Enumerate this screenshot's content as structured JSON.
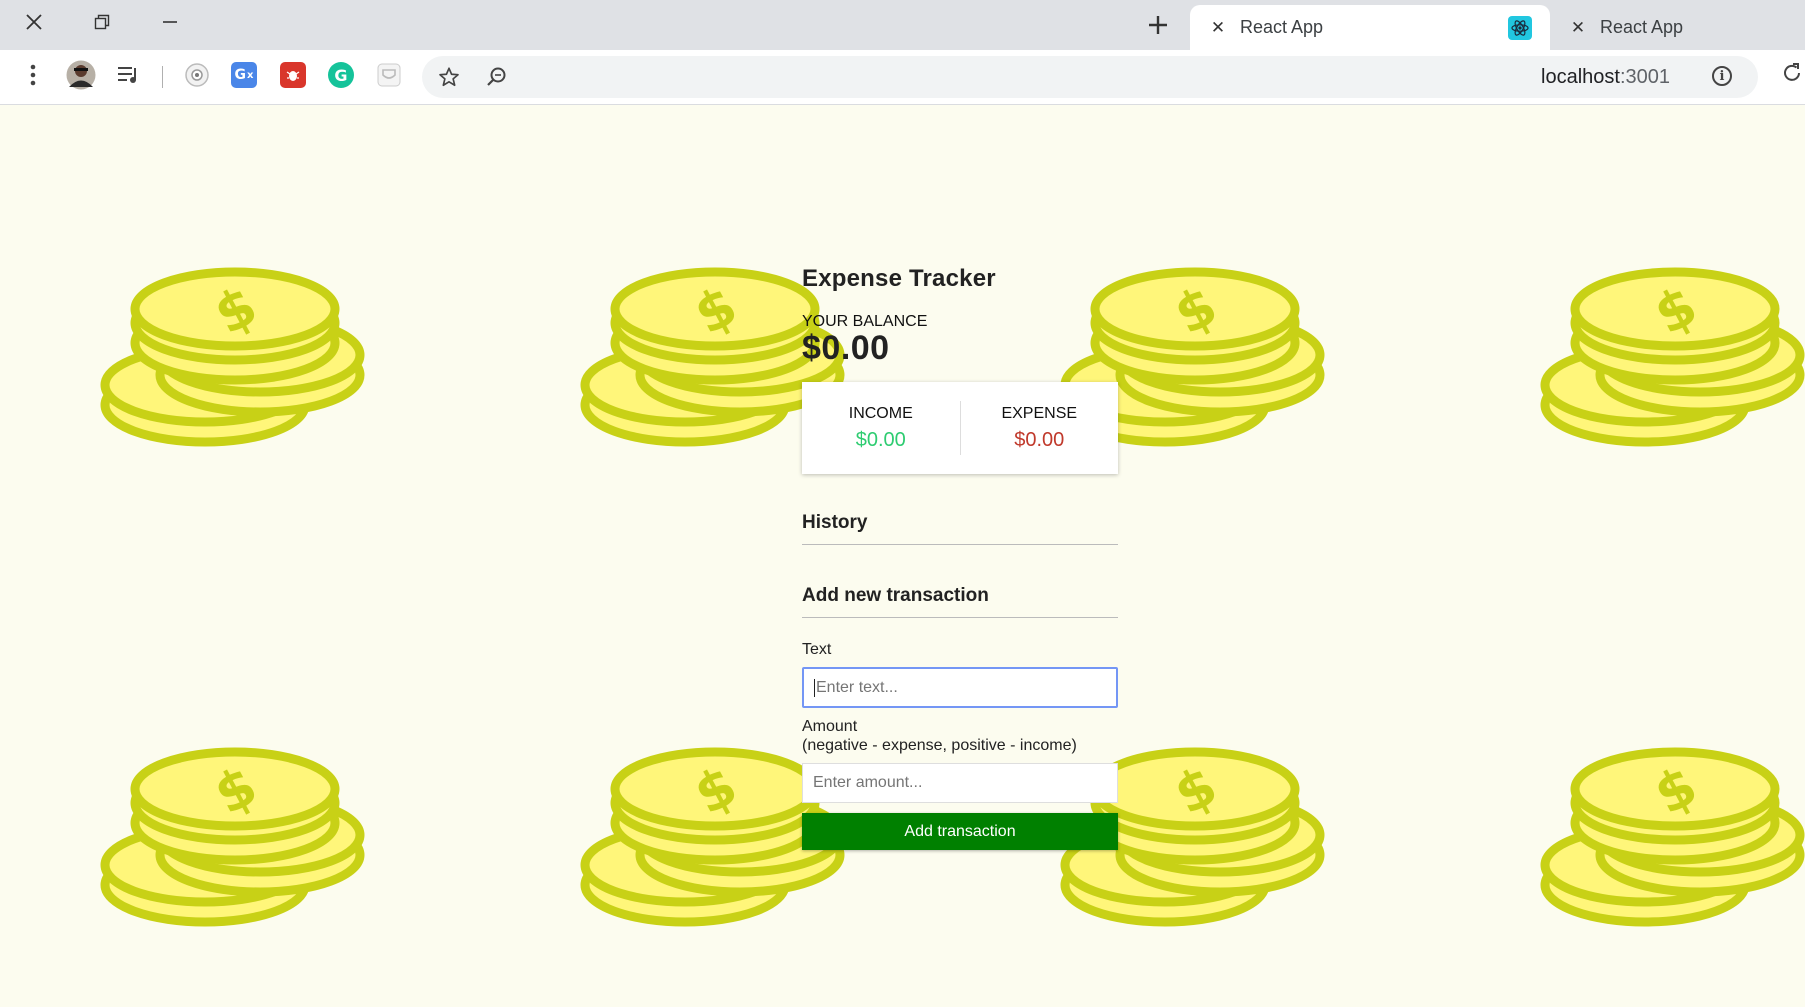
{
  "browser": {
    "tabs": [
      {
        "label": "React App",
        "active": true
      },
      {
        "label": "React App",
        "active": false
      }
    ],
    "url_host": "localhost",
    "url_port": ":3001",
    "extension_icons": [
      "profile-avatar-icon",
      "media-control-icon",
      "camera-extension-icon",
      "google-translate-icon",
      "bug-extension-icon",
      "grammarly-icon",
      "pocket-extension-icon"
    ]
  },
  "app": {
    "title": "Expense Tracker",
    "balance_label": "YOUR BALANCE",
    "balance_value": "$0.00",
    "income_label": "INCOME",
    "income_value": "$0.00",
    "expense_label": "EXPENSE",
    "expense_value": "$0.00",
    "history_title": "History",
    "add_title": "Add new transaction",
    "text_label": "Text",
    "text_placeholder": "Enter text...",
    "amount_label": "Amount",
    "amount_hint": "(negative - expense, positive - income)",
    "amount_placeholder": "Enter amount...",
    "add_button": "Add transaction"
  },
  "colors": {
    "page_bg": "#fcfcef",
    "income": "#2ecc71",
    "expense": "#c0392b",
    "button": "#008000",
    "coin_fill": "#fff67a",
    "coin_stroke": "#c8d116"
  }
}
